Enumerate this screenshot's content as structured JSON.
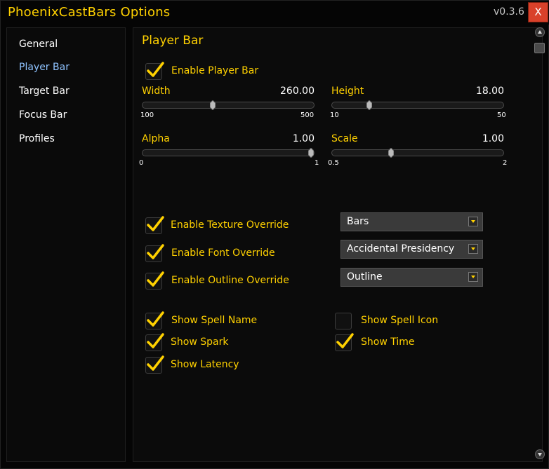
{
  "window": {
    "title": "PhoenixCastBars Options",
    "version": "v0.3.6",
    "close_label": "X"
  },
  "sidebar": {
    "items": [
      {
        "label": "General",
        "active": false
      },
      {
        "label": "Player Bar",
        "active": true
      },
      {
        "label": "Target Bar",
        "active": false
      },
      {
        "label": "Focus Bar",
        "active": false
      },
      {
        "label": "Profiles",
        "active": false
      }
    ]
  },
  "main": {
    "section_title": "Player Bar",
    "enable_player_bar": {
      "label": "Enable Player Bar",
      "checked": true
    },
    "sliders": {
      "width": {
        "label": "Width",
        "value": "260.00",
        "min": "100",
        "max": "500",
        "current": 260
      },
      "height": {
        "label": "Height",
        "value": "18.00",
        "min": "10",
        "max": "50",
        "current": 18
      },
      "alpha": {
        "label": "Alpha",
        "value": "1.00",
        "min": "0",
        "max": "1",
        "current": 1
      },
      "scale": {
        "label": "Scale",
        "value": "1.00",
        "min": "0.5",
        "max": "2",
        "current": 1
      }
    },
    "overrides": {
      "texture": {
        "label": "Enable Texture Override",
        "checked": true,
        "dropdown": "Bars"
      },
      "font": {
        "label": "Enable Font Override",
        "checked": true,
        "dropdown": "Accidental Presidency"
      },
      "outline": {
        "label": "Enable Outline Override",
        "checked": true,
        "dropdown": "Outline"
      }
    },
    "toggles": {
      "spell_name": {
        "label": "Show Spell Name",
        "checked": true
      },
      "spark": {
        "label": "Show Spark",
        "checked": true
      },
      "latency": {
        "label": "Show Latency",
        "checked": true
      },
      "spell_icon": {
        "label": "Show Spell Icon",
        "checked": false
      },
      "time": {
        "label": "Show Time",
        "checked": true
      }
    }
  },
  "colors": {
    "accent": "#ffd100",
    "active_nav": "#8fc3ff",
    "close": "#d9412a"
  }
}
